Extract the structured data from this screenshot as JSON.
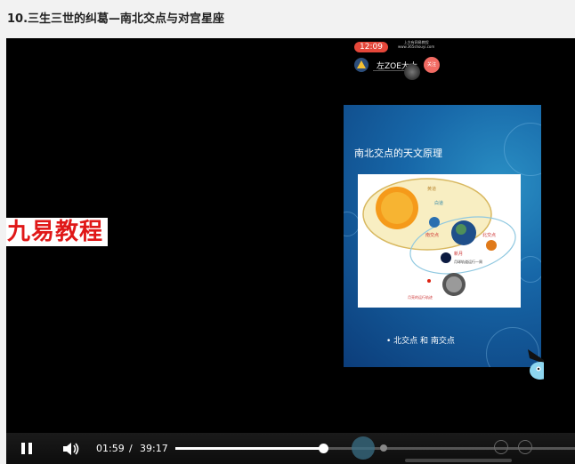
{
  "page": {
    "title": "10.三生三世的纠葛—南北交点与对宫星座"
  },
  "player": {
    "watermark": "九易教程",
    "stream": {
      "time": "12:09",
      "site_line1": "上方有网易教程",
      "site_line2": "www.365shouyi.com",
      "host_name": "左ZOE大大",
      "follow_label": "关注"
    },
    "slide": {
      "title": "南北交点的天文原理",
      "bullet": "• 北交点 和 南交点",
      "diagram": {
        "ecliptic": "黄道",
        "moon_orbit": "白道",
        "south_node": "南交点",
        "north_node": "北交点",
        "new_moon": "新月",
        "moon_path_note": "月球轨道运行一周",
        "full_moon_note": "月亮的运行轨迹"
      }
    },
    "controls": {
      "current_time": "01:59",
      "separator": "/",
      "total_time": "39:17",
      "progress_fraction": 0.0505
    }
  },
  "colors": {
    "accent": "#ffffff",
    "watermark": "#e01818",
    "slide_bg": "#1767a8"
  }
}
